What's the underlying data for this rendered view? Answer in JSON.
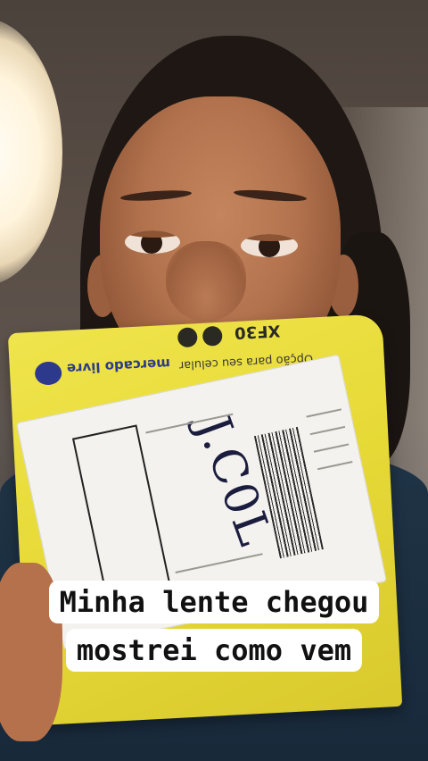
{
  "caption": {
    "line1": "Minha lente chegou",
    "line2": "mostrei como vem"
  },
  "package": {
    "brand_logo_text": "mercado livre",
    "top_code": "XF30",
    "top_strip_text": "Opção para seu celular",
    "handwritten_note": "J.C0L"
  },
  "colors": {
    "package_yellow": "#e6d936",
    "label_white": "#f3f2ee",
    "caption_bg": "#ffffff",
    "caption_text": "#111111"
  }
}
